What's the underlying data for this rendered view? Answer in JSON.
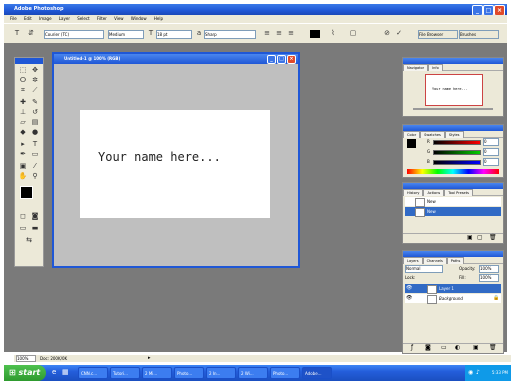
{
  "app": {
    "title": "Adobe Photoshop"
  },
  "menu": [
    "File",
    "Edit",
    "Image",
    "Layer",
    "Select",
    "Filter",
    "View",
    "Window",
    "Help"
  ],
  "options": {
    "font_family": "Courier (TC)",
    "font_style": "Medium",
    "font_size": "18 pt",
    "antialias": "Sharp",
    "file_browser_tab": "File Browser",
    "brushes_tab": "Brushes"
  },
  "document": {
    "title": "Untitled-1 @ 100% (RGB)",
    "canvas_text": "Your name here..."
  },
  "panels": {
    "navigator": {
      "tabs": [
        "Navigator",
        "Info"
      ],
      "thumb_text": "Your name here..."
    },
    "color": {
      "tabs": [
        "Color",
        "Swatches",
        "Styles"
      ],
      "channels": [
        "R",
        "G",
        "B"
      ],
      "values": [
        "0",
        "0",
        "0"
      ]
    },
    "history": {
      "tabs": [
        "History",
        "Actions",
        "Tool Presets"
      ],
      "items": [
        "New",
        "New"
      ]
    },
    "layers": {
      "tabs": [
        "Layers",
        "Channels",
        "Paths"
      ],
      "blend_mode": "Normal",
      "opacity_label": "Opacity:",
      "opacity_value": "100%",
      "lock_label": "Lock:",
      "fill_label": "Fill:",
      "fill_value": "100%",
      "layers": [
        "Layer 1",
        "Background"
      ]
    }
  },
  "status": {
    "zoom": "100%",
    "doc": "Doc: 200K/0K"
  },
  "taskbar": {
    "start": "start",
    "tasks": [
      "CNN.c...",
      "Tutori...",
      "2 Mi...",
      "Photo...",
      "2 In...",
      "2 Wi...",
      "Photo...",
      "Adobe..."
    ],
    "clock": "5:33 PM"
  }
}
